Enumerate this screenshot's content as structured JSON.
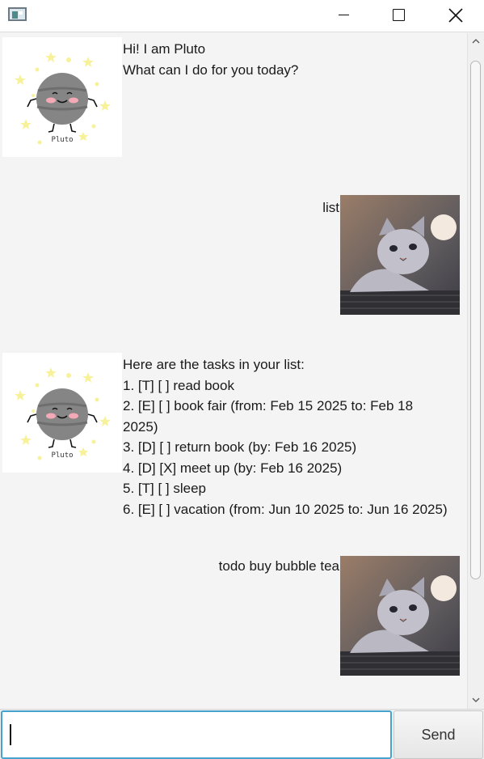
{
  "window": {
    "icons": {
      "app": "java-app-icon",
      "minimize": "minimize-icon",
      "maximize": "maximize-icon",
      "close": "close-icon"
    }
  },
  "chat": {
    "messages": [
      {
        "from": "bot",
        "avatar": "pluto-planet-avatar",
        "avatar_caption": "Pluto",
        "text": "Hi! I am Pluto\nWhat can I do for you today?"
      },
      {
        "from": "user",
        "avatar": "cat-avatar",
        "text": "list"
      },
      {
        "from": "bot",
        "avatar": "pluto-planet-avatar",
        "avatar_caption": "Pluto",
        "text": "Here are the tasks in your list:\n1. [T] [ ] read book\n2. [E] [ ] book fair (from: Feb 15 2025 to: Feb 18\n2025)\n3. [D] [ ] return book (by: Feb 16 2025)\n4. [D] [X] meet up (by: Feb 16 2025)\n5. [T] [ ] sleep\n6. [E] [ ] vacation (from: Jun 10 2025 to: Jun 16 2025)"
      },
      {
        "from": "user",
        "avatar": "cat-avatar",
        "text": "todo buy bubble tea"
      }
    ]
  },
  "input": {
    "value": "",
    "placeholder": ""
  },
  "send_button": {
    "label": "Send"
  },
  "colors": {
    "input_focus_border": "#46a3ce",
    "chat_background": "#f4f4f4",
    "planet": "#858585",
    "stars": "#f7f29a"
  }
}
